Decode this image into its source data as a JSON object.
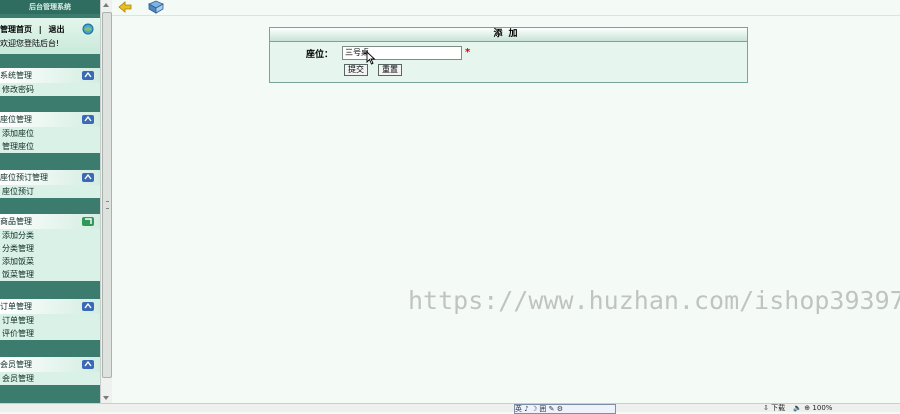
{
  "sidebar": {
    "title": "后台管理系统",
    "top_links": {
      "home": "管理首页",
      "separator": "|",
      "logout": "退出"
    },
    "welcome": "欢迎您登陆后台!",
    "menus": [
      {
        "title": "系统管理",
        "items": [
          "修改密码"
        ]
      },
      {
        "title": "座位管理",
        "items": [
          "添加座位",
          "管理座位"
        ]
      },
      {
        "title": "座位预订管理",
        "items": [
          "座位预订"
        ]
      },
      {
        "title": "商品管理",
        "items": [
          "添加分类",
          "分类管理",
          "添加饭菜",
          "饭菜管理"
        ]
      },
      {
        "title": "订单管理",
        "items": [
          "订单管理",
          "评价管理"
        ]
      },
      {
        "title": "会员管理",
        "items": [
          "会员管理"
        ]
      }
    ]
  },
  "toolbar": {
    "icons": [
      "back-arrow-icon",
      "book-icon"
    ]
  },
  "form": {
    "title": "添加",
    "seat_label": "座位：",
    "seat_value": "三号桌",
    "required_mark": "*",
    "submit_label": "提交",
    "reset_label": "重置"
  },
  "watermark": "https://www.huzhan.com/ishop39397",
  "statusbar": {
    "ime_text": "英 ♪ ☽ 囲 ✎ ⚙",
    "download": "下载",
    "zoom": "100%"
  },
  "colors": {
    "sidebar_bg": "#3b7c6e",
    "menu_items_bg": "#d9f1e7",
    "main_bg": "#f4fbf7",
    "required": "#d40000"
  }
}
